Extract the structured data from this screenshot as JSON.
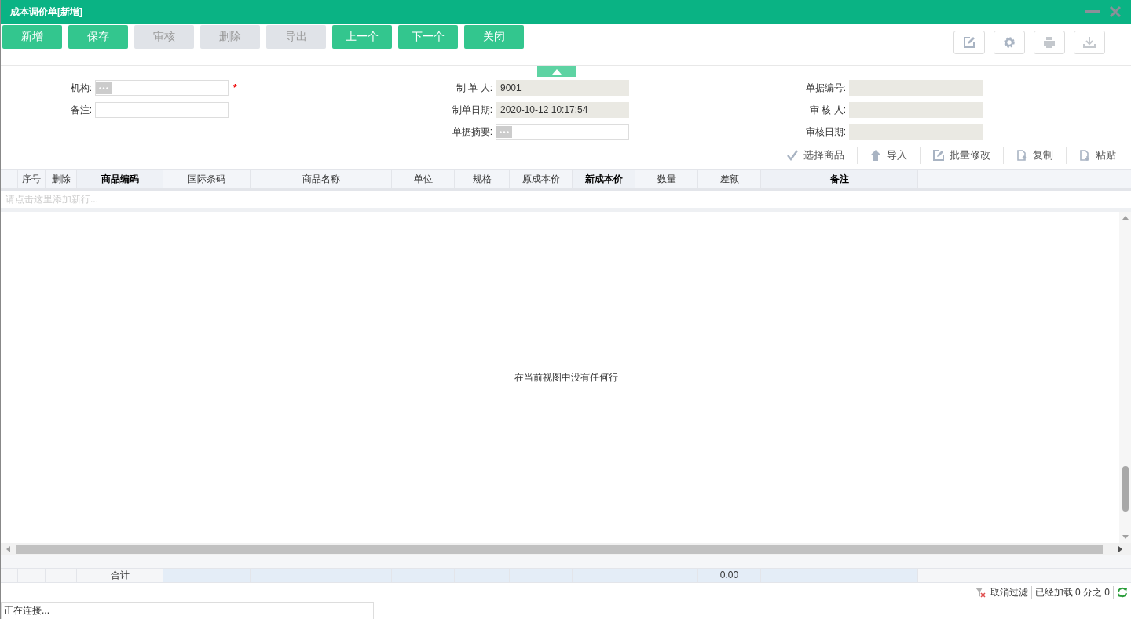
{
  "window": {
    "title": "成本调价单[新增]"
  },
  "toolbar": [
    {
      "label": "新增",
      "disabled": false
    },
    {
      "label": "保存",
      "disabled": false
    },
    {
      "label": "审核",
      "disabled": true
    },
    {
      "label": "删除",
      "disabled": true
    },
    {
      "label": "导出",
      "disabled": true
    },
    {
      "label": "上一个",
      "disabled": false
    },
    {
      "label": "下一个",
      "disabled": false
    },
    {
      "label": "关闭",
      "disabled": false
    }
  ],
  "form": {
    "columns": [
      [
        {
          "label": "机构:",
          "readonly": false,
          "picker": true,
          "required_mark": "*"
        },
        {
          "label": "备注:",
          "readonly": false,
          "picker": false
        }
      ],
      [
        {
          "label": "制 单 人:",
          "value": "9001",
          "readonly": true,
          "picker": false
        },
        {
          "label": "制单日期:",
          "value": "2020-10-12 10:17:54",
          "readonly": true,
          "picker": false
        },
        {
          "label": "单据摘要:",
          "readonly": false,
          "picker": true
        }
      ],
      [
        {
          "label": "单据编号:",
          "readonly": true,
          "picker": false
        },
        {
          "label": "审 核 人:",
          "readonly": true,
          "picker": false
        },
        {
          "label": "审核日期:",
          "readonly": true,
          "picker": false
        }
      ]
    ]
  },
  "grid_actions": [
    {
      "kind": "check",
      "label": "选择商品"
    },
    {
      "kind": "upload",
      "label": "导入"
    },
    {
      "kind": "edit",
      "label": "批量修改"
    },
    {
      "kind": "copy",
      "label": "复制"
    },
    {
      "kind": "paste",
      "label": "粘贴"
    }
  ],
  "table": {
    "columns": [
      {
        "label": "序号",
        "bold": false
      },
      {
        "label": "删除",
        "bold": false
      },
      {
        "label": "商品编码",
        "bold": true,
        "total": "合计"
      },
      {
        "label": "国际条码",
        "bold": false
      },
      {
        "label": "商品名称",
        "bold": false
      },
      {
        "label": "单位",
        "bold": false
      },
      {
        "label": "规格",
        "bold": false
      },
      {
        "label": "原成本价",
        "bold": false
      },
      {
        "label": "新成本价",
        "bold": true
      },
      {
        "label": "数量",
        "bold": false
      },
      {
        "label": "差额",
        "bold": false,
        "total": "0.00"
      },
      {
        "label": "备注",
        "bold": true
      }
    ],
    "add_row_hint": "请点击这里添加新行...",
    "empty_message": "在当前视图中没有任何行"
  },
  "status_bar": {
    "clear_filter": "取消过滤",
    "loaded": "已经加载 0 分之 0"
  },
  "connection_status": "正在连接..."
}
